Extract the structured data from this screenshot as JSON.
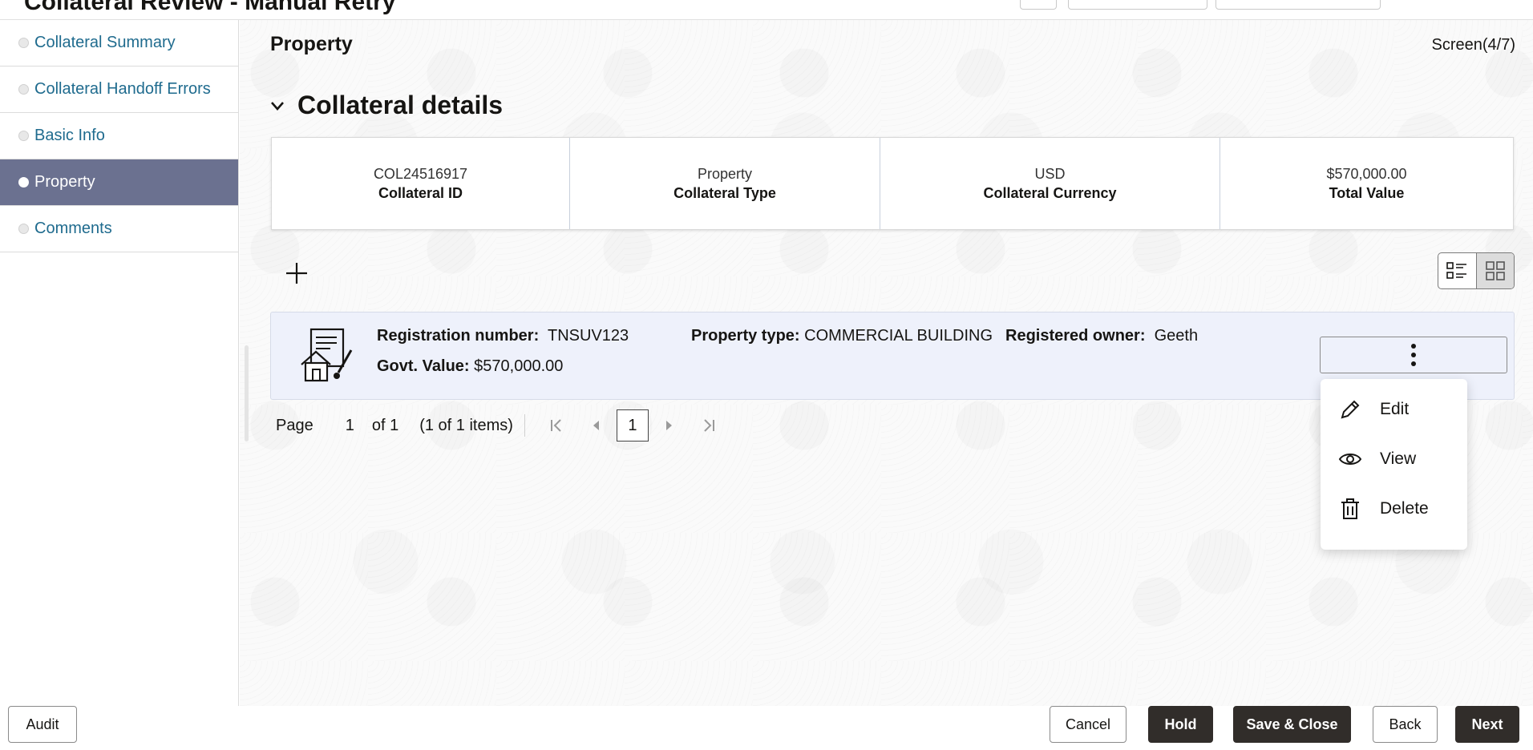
{
  "header": {
    "title": "Collateral Review - Manual Retry"
  },
  "sidebar": {
    "items": [
      {
        "label": "Collateral Summary"
      },
      {
        "label": "Collateral Handoff Errors"
      },
      {
        "label": "Basic Info"
      },
      {
        "label": "Property",
        "active": true
      },
      {
        "label": "Comments"
      }
    ]
  },
  "main": {
    "page_title": "Property",
    "screen_indicator": "Screen(4/7)",
    "section_title": "Collateral details",
    "summary": [
      {
        "value": "COL24516917",
        "label": "Collateral ID"
      },
      {
        "value": "Property",
        "label": "Collateral Type"
      },
      {
        "value": "USD",
        "label": "Collateral Currency"
      },
      {
        "value": "$570,000.00",
        "label": "Total Value"
      }
    ],
    "record": {
      "registration_label": "Registration number:",
      "registration_value": "TNSUV123",
      "property_type_label": "Property type:",
      "property_type_value": "COMMERCIAL BUILDING",
      "owner_label": "Registered owner:",
      "owner_value": "Geeth",
      "govt_value_label": "Govt. Value:",
      "govt_value_value": "$570,000.00"
    },
    "pager": {
      "page_label": "Page",
      "page_input": "1",
      "of_label": "of 1",
      "items_label": "(1 of 1 items)",
      "current_page": "1"
    },
    "menu": {
      "items": [
        {
          "label": "Edit",
          "icon": "pencil-icon"
        },
        {
          "label": "View",
          "icon": "eye-icon"
        },
        {
          "label": "Delete",
          "icon": "trash-icon"
        }
      ]
    }
  },
  "footer": {
    "audit": "Audit",
    "cancel": "Cancel",
    "hold": "Hold",
    "save_close": "Save & Close",
    "back": "Back",
    "next": "Next"
  },
  "colors": {
    "active_nav": "#6b7190",
    "link": "#1f6b8e",
    "record_bg": "#eef1fb",
    "dark_button": "#312d2a"
  }
}
